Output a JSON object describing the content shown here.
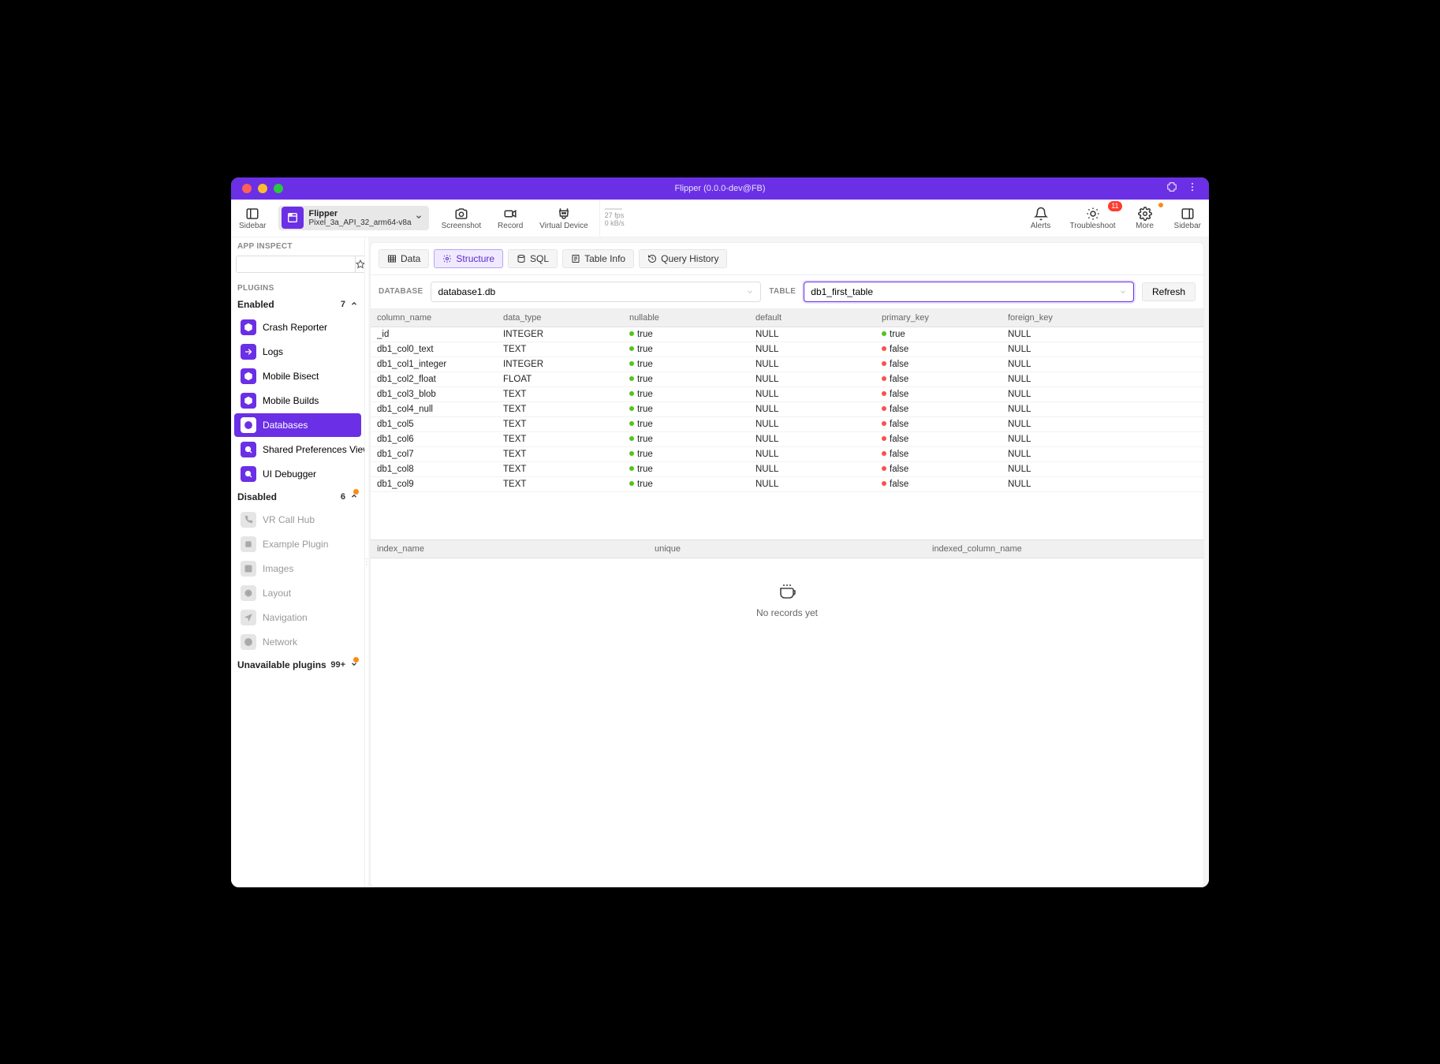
{
  "titlebar": {
    "title": "Flipper (0.0.0-dev@FB)"
  },
  "toolbar": {
    "sidebar": "Sidebar",
    "device_app": "Flipper",
    "device_name": "Pixel_3a_API_32_arm64-v8a",
    "screenshot": "Screenshot",
    "record": "Record",
    "virtual_device": "Virtual Device",
    "fps": "27 fps",
    "bandwidth": "0 kB/s",
    "alerts": "Alerts",
    "troubleshoot": "Troubleshoot",
    "troubleshoot_badge": "11",
    "more": "More",
    "sidebar2": "Sidebar"
  },
  "sidebar": {
    "app_inspect": "APP INSPECT",
    "plugins": "PLUGINS",
    "enabled": {
      "label": "Enabled",
      "count": "7"
    },
    "enabled_items": [
      {
        "label": "Crash Reporter",
        "icon": "cube"
      },
      {
        "label": "Logs",
        "icon": "arrow-right"
      },
      {
        "label": "Mobile Bisect",
        "icon": "cube"
      },
      {
        "label": "Mobile Builds",
        "icon": "cube"
      },
      {
        "label": "Databases",
        "icon": "globe",
        "active": true
      },
      {
        "label": "Shared Preferences Viewer",
        "icon": "search"
      },
      {
        "label": "UI Debugger",
        "icon": "search"
      }
    ],
    "disabled": {
      "label": "Disabled",
      "count": "6"
    },
    "disabled_items": [
      {
        "label": "VR Call Hub",
        "icon": "phone"
      },
      {
        "label": "Example Plugin",
        "icon": "square"
      },
      {
        "label": "Images",
        "icon": "image"
      },
      {
        "label": "Layout",
        "icon": "target"
      },
      {
        "label": "Navigation",
        "icon": "nav"
      },
      {
        "label": "Network",
        "icon": "globe"
      }
    ],
    "unavailable": {
      "label": "Unavailable plugins",
      "count": "99+"
    }
  },
  "tabs": {
    "data": "Data",
    "structure": "Structure",
    "sql": "SQL",
    "table_info": "Table Info",
    "query_history": "Query History"
  },
  "selectors": {
    "database_label": "DATABASE",
    "database_value": "database1.db",
    "table_label": "TABLE",
    "table_value": "db1_first_table",
    "refresh": "Refresh"
  },
  "columns_table": {
    "headers": [
      "column_name",
      "data_type",
      "nullable",
      "default",
      "primary_key",
      "foreign_key"
    ],
    "rows": [
      {
        "name": "_id",
        "type": "INTEGER",
        "nullable": "true",
        "default": "NULL",
        "pk": "true",
        "fk": "NULL"
      },
      {
        "name": "db1_col0_text",
        "type": "TEXT",
        "nullable": "true",
        "default": "NULL",
        "pk": "false",
        "fk": "NULL"
      },
      {
        "name": "db1_col1_integer",
        "type": "INTEGER",
        "nullable": "true",
        "default": "NULL",
        "pk": "false",
        "fk": "NULL"
      },
      {
        "name": "db1_col2_float",
        "type": "FLOAT",
        "nullable": "true",
        "default": "NULL",
        "pk": "false",
        "fk": "NULL"
      },
      {
        "name": "db1_col3_blob",
        "type": "TEXT",
        "nullable": "true",
        "default": "NULL",
        "pk": "false",
        "fk": "NULL"
      },
      {
        "name": "db1_col4_null",
        "type": "TEXT",
        "nullable": "true",
        "default": "NULL",
        "pk": "false",
        "fk": "NULL"
      },
      {
        "name": "db1_col5",
        "type": "TEXT",
        "nullable": "true",
        "default": "NULL",
        "pk": "false",
        "fk": "NULL"
      },
      {
        "name": "db1_col6",
        "type": "TEXT",
        "nullable": "true",
        "default": "NULL",
        "pk": "false",
        "fk": "NULL"
      },
      {
        "name": "db1_col7",
        "type": "TEXT",
        "nullable": "true",
        "default": "NULL",
        "pk": "false",
        "fk": "NULL"
      },
      {
        "name": "db1_col8",
        "type": "TEXT",
        "nullable": "true",
        "default": "NULL",
        "pk": "false",
        "fk": "NULL"
      },
      {
        "name": "db1_col9",
        "type": "TEXT",
        "nullable": "true",
        "default": "NULL",
        "pk": "false",
        "fk": "NULL"
      }
    ]
  },
  "index_table": {
    "headers": [
      "index_name",
      "unique",
      "indexed_column_name"
    ],
    "empty": "No records yet"
  }
}
